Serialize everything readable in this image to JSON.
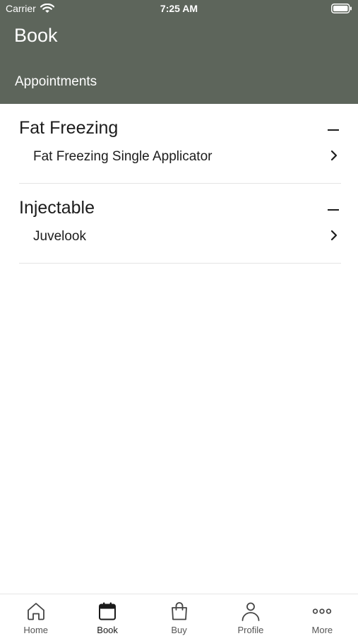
{
  "status_bar": {
    "carrier": "Carrier",
    "time": "7:25 AM"
  },
  "header": {
    "title": "Book",
    "subtitle": "Appointments"
  },
  "sections": [
    {
      "title": "Fat Freezing",
      "items": [
        {
          "label": "Fat Freezing Single Applicator"
        }
      ]
    },
    {
      "title": "Injectable",
      "items": [
        {
          "label": "Juvelook"
        }
      ]
    }
  ],
  "tab_bar": {
    "active": "book",
    "tabs": [
      {
        "id": "home",
        "label": "Home",
        "icon": "home-icon"
      },
      {
        "id": "book",
        "label": "Book",
        "icon": "calendar-icon"
      },
      {
        "id": "buy",
        "label": "Buy",
        "icon": "shopping-bag-icon"
      },
      {
        "id": "profile",
        "label": "Profile",
        "icon": "person-icon"
      },
      {
        "id": "more",
        "label": "More",
        "icon": "more-dots-icon"
      }
    ]
  },
  "colors": {
    "header_bg": "#5d655b",
    "text_primary": "#1c1c1c",
    "divider": "#e4e4e4"
  }
}
